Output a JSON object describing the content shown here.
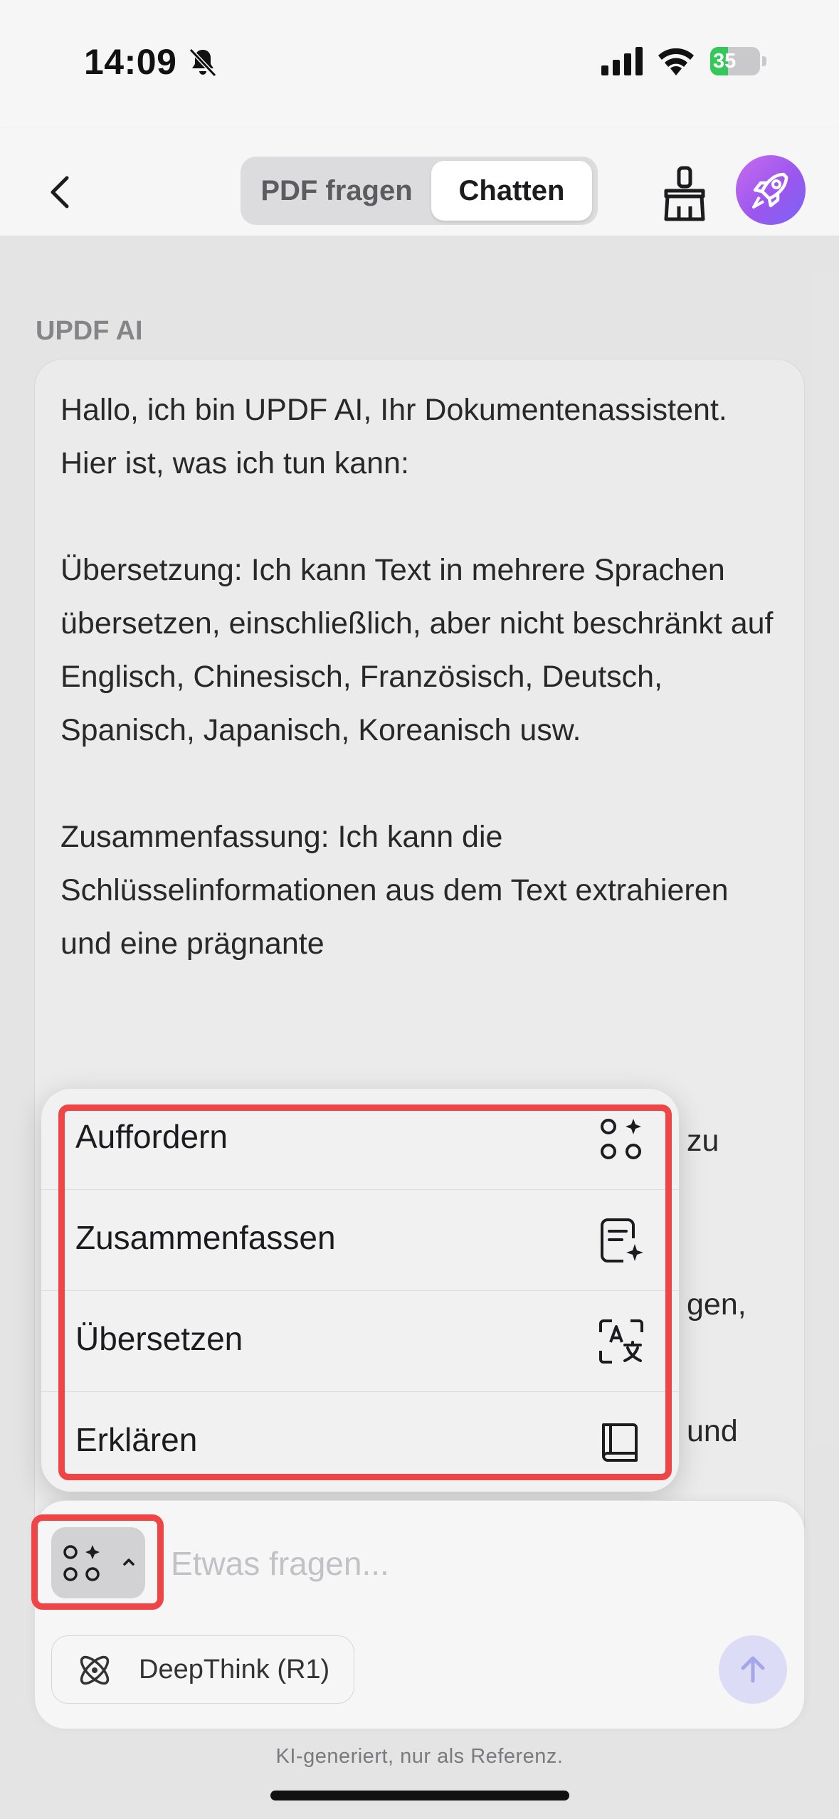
{
  "status_bar": {
    "time": "14:09",
    "battery_level": "35",
    "battery_fraction": 0.35
  },
  "nav": {
    "segments": [
      "PDF fragen",
      "Chatten"
    ],
    "selected_segment": "Chatten",
    "icons": {
      "back": "chevron-left-icon",
      "clean": "broom-icon",
      "rocket": "rocket-icon"
    },
    "accent": "#a45ff0"
  },
  "chat": {
    "sender": "UPDF AI",
    "message_paragraphs": [
      "Hallo, ich bin UPDF AI, Ihr Dokumentenassistent. Hier ist, was ich tun kann:",
      "Übersetzung: Ich kann Text in mehrere Sprachen übersetzen, einschließlich, aber nicht beschränkt auf Englisch, Chinesisch, Französisch, Deutsch, Spanisch, Japanisch, Koreanisch usw.",
      "Zusammenfassung: Ich kann die Schlüsselinformationen aus dem Text extrahieren und eine prägnante"
    ],
    "partially_visible_fragments": [
      "zu",
      "gen,",
      "und"
    ]
  },
  "popup_menu": {
    "items": [
      {
        "label": "Auffordern",
        "icon": "prompt-grid-icon"
      },
      {
        "label": "Zusammenfassen",
        "icon": "summarize-icon"
      },
      {
        "label": "Übersetzen",
        "icon": "translate-icon"
      },
      {
        "label": "Erklären",
        "icon": "book-icon"
      }
    ],
    "highlight_color": "#ef4547"
  },
  "composer": {
    "placeholder": "Etwas fragen...",
    "deepthink_label": "DeepThink (R1)",
    "send_icon": "arrow-up-icon"
  },
  "footer": {
    "disclaimer": "KI-generiert, nur als Referenz."
  }
}
